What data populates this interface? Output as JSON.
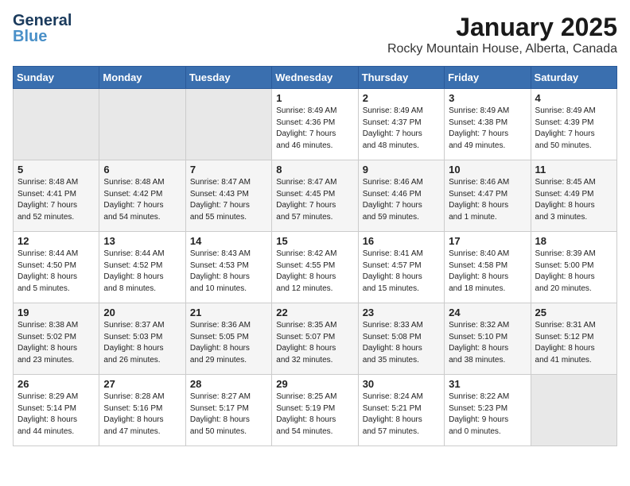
{
  "header": {
    "logo_line1": "General",
    "logo_line2": "Blue",
    "month": "January 2025",
    "location": "Rocky Mountain House, Alberta, Canada"
  },
  "weekdays": [
    "Sunday",
    "Monday",
    "Tuesday",
    "Wednesday",
    "Thursday",
    "Friday",
    "Saturday"
  ],
  "weeks": [
    [
      {
        "day": "",
        "info": ""
      },
      {
        "day": "",
        "info": ""
      },
      {
        "day": "",
        "info": ""
      },
      {
        "day": "1",
        "info": "Sunrise: 8:49 AM\nSunset: 4:36 PM\nDaylight: 7 hours\nand 46 minutes."
      },
      {
        "day": "2",
        "info": "Sunrise: 8:49 AM\nSunset: 4:37 PM\nDaylight: 7 hours\nand 48 minutes."
      },
      {
        "day": "3",
        "info": "Sunrise: 8:49 AM\nSunset: 4:38 PM\nDaylight: 7 hours\nand 49 minutes."
      },
      {
        "day": "4",
        "info": "Sunrise: 8:49 AM\nSunset: 4:39 PM\nDaylight: 7 hours\nand 50 minutes."
      }
    ],
    [
      {
        "day": "5",
        "info": "Sunrise: 8:48 AM\nSunset: 4:41 PM\nDaylight: 7 hours\nand 52 minutes."
      },
      {
        "day": "6",
        "info": "Sunrise: 8:48 AM\nSunset: 4:42 PM\nDaylight: 7 hours\nand 54 minutes."
      },
      {
        "day": "7",
        "info": "Sunrise: 8:47 AM\nSunset: 4:43 PM\nDaylight: 7 hours\nand 55 minutes."
      },
      {
        "day": "8",
        "info": "Sunrise: 8:47 AM\nSunset: 4:45 PM\nDaylight: 7 hours\nand 57 minutes."
      },
      {
        "day": "9",
        "info": "Sunrise: 8:46 AM\nSunset: 4:46 PM\nDaylight: 7 hours\nand 59 minutes."
      },
      {
        "day": "10",
        "info": "Sunrise: 8:46 AM\nSunset: 4:47 PM\nDaylight: 8 hours\nand 1 minute."
      },
      {
        "day": "11",
        "info": "Sunrise: 8:45 AM\nSunset: 4:49 PM\nDaylight: 8 hours\nand 3 minutes."
      }
    ],
    [
      {
        "day": "12",
        "info": "Sunrise: 8:44 AM\nSunset: 4:50 PM\nDaylight: 8 hours\nand 5 minutes."
      },
      {
        "day": "13",
        "info": "Sunrise: 8:44 AM\nSunset: 4:52 PM\nDaylight: 8 hours\nand 8 minutes."
      },
      {
        "day": "14",
        "info": "Sunrise: 8:43 AM\nSunset: 4:53 PM\nDaylight: 8 hours\nand 10 minutes."
      },
      {
        "day": "15",
        "info": "Sunrise: 8:42 AM\nSunset: 4:55 PM\nDaylight: 8 hours\nand 12 minutes."
      },
      {
        "day": "16",
        "info": "Sunrise: 8:41 AM\nSunset: 4:57 PM\nDaylight: 8 hours\nand 15 minutes."
      },
      {
        "day": "17",
        "info": "Sunrise: 8:40 AM\nSunset: 4:58 PM\nDaylight: 8 hours\nand 18 minutes."
      },
      {
        "day": "18",
        "info": "Sunrise: 8:39 AM\nSunset: 5:00 PM\nDaylight: 8 hours\nand 20 minutes."
      }
    ],
    [
      {
        "day": "19",
        "info": "Sunrise: 8:38 AM\nSunset: 5:02 PM\nDaylight: 8 hours\nand 23 minutes."
      },
      {
        "day": "20",
        "info": "Sunrise: 8:37 AM\nSunset: 5:03 PM\nDaylight: 8 hours\nand 26 minutes."
      },
      {
        "day": "21",
        "info": "Sunrise: 8:36 AM\nSunset: 5:05 PM\nDaylight: 8 hours\nand 29 minutes."
      },
      {
        "day": "22",
        "info": "Sunrise: 8:35 AM\nSunset: 5:07 PM\nDaylight: 8 hours\nand 32 minutes."
      },
      {
        "day": "23",
        "info": "Sunrise: 8:33 AM\nSunset: 5:08 PM\nDaylight: 8 hours\nand 35 minutes."
      },
      {
        "day": "24",
        "info": "Sunrise: 8:32 AM\nSunset: 5:10 PM\nDaylight: 8 hours\nand 38 minutes."
      },
      {
        "day": "25",
        "info": "Sunrise: 8:31 AM\nSunset: 5:12 PM\nDaylight: 8 hours\nand 41 minutes."
      }
    ],
    [
      {
        "day": "26",
        "info": "Sunrise: 8:29 AM\nSunset: 5:14 PM\nDaylight: 8 hours\nand 44 minutes."
      },
      {
        "day": "27",
        "info": "Sunrise: 8:28 AM\nSunset: 5:16 PM\nDaylight: 8 hours\nand 47 minutes."
      },
      {
        "day": "28",
        "info": "Sunrise: 8:27 AM\nSunset: 5:17 PM\nDaylight: 8 hours\nand 50 minutes."
      },
      {
        "day": "29",
        "info": "Sunrise: 8:25 AM\nSunset: 5:19 PM\nDaylight: 8 hours\nand 54 minutes."
      },
      {
        "day": "30",
        "info": "Sunrise: 8:24 AM\nSunset: 5:21 PM\nDaylight: 8 hours\nand 57 minutes."
      },
      {
        "day": "31",
        "info": "Sunrise: 8:22 AM\nSunset: 5:23 PM\nDaylight: 9 hours\nand 0 minutes."
      },
      {
        "day": "",
        "info": ""
      }
    ]
  ]
}
